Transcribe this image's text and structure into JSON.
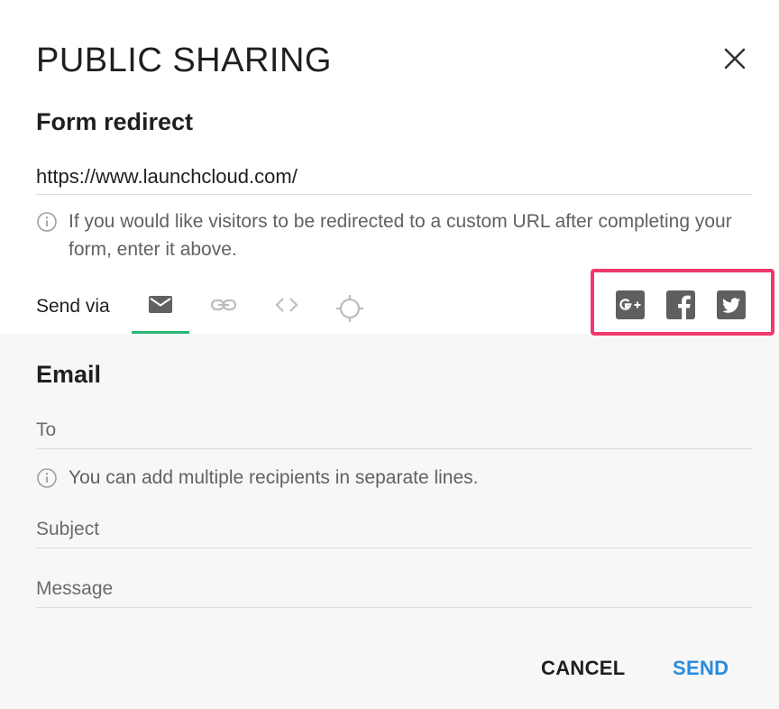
{
  "dialog": {
    "title": "PUBLIC SHARING",
    "close_icon": "close-icon"
  },
  "redirect": {
    "heading": "Form redirect",
    "url_value": "https://www.launchcloud.com/",
    "hint": "If you would like visitors to be redirected to a custom URL after completing your form, enter it above.",
    "hint_icon": "info-icon"
  },
  "send_via": {
    "label": "Send via",
    "tabs": [
      {
        "icon": "email-icon",
        "active": true
      },
      {
        "icon": "link-icon",
        "active": false
      },
      {
        "icon": "embed-code-icon",
        "active": false
      },
      {
        "icon": "target-icon",
        "active": false
      }
    ],
    "social": [
      {
        "icon": "google-plus-icon"
      },
      {
        "icon": "facebook-icon"
      },
      {
        "icon": "twitter-icon"
      }
    ]
  },
  "email": {
    "heading": "Email",
    "to_placeholder": "To",
    "recipients_hint": "You can add multiple recipients in separate lines.",
    "subject_placeholder": "Subject",
    "message_placeholder": "Message"
  },
  "actions": {
    "cancel_label": "CANCEL",
    "send_label": "SEND"
  },
  "colors": {
    "tab_active_underline": "#2bb673",
    "send_button": "#2b8be0",
    "social_highlight": "#f0386b",
    "icon_gray": "#9e9e9e",
    "social_icon": "#5f5f5f"
  }
}
